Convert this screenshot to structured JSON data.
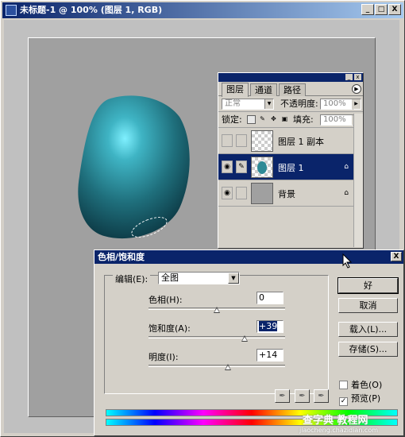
{
  "window": {
    "title": "未标题-1 @ 100% (图层 1, RGB)",
    "min": "_",
    "max": "□",
    "close": "X"
  },
  "layers_panel": {
    "tabs": [
      "图层",
      "通道",
      "路径"
    ],
    "blend_mode": "正常",
    "opacity_label": "不透明度:",
    "opacity_value": "100%",
    "lock_label": "锁定:",
    "fill_label": "填充:",
    "fill_value": "100%",
    "layers": [
      {
        "name": "图层 1 副本",
        "visible": false,
        "selected": false
      },
      {
        "name": "图层 1",
        "visible": true,
        "selected": true
      },
      {
        "name": "背景",
        "visible": true,
        "selected": false
      }
    ]
  },
  "dialog": {
    "title": "色相/饱和度",
    "edit_label": "编辑(E):",
    "edit_value": "全图",
    "hue_label": "色相(H):",
    "hue_value": "0",
    "saturation_label": "饱和度(A):",
    "saturation_value": "+39",
    "lightness_label": "明度(I):",
    "lightness_value": "+14",
    "ok": "好",
    "cancel": "取消",
    "load": "载入(L)...",
    "save": "存储(S)...",
    "colorize": "着色(O)",
    "preview": "预览(P)",
    "colorize_checked": false,
    "preview_checked": true
  },
  "watermark": {
    "line1": "查字典 教程网",
    "line2": "jiaocheng.chazidian.com"
  },
  "colors": {
    "title_blue": "#0a246a",
    "blob_teal": "#2e8a96"
  }
}
